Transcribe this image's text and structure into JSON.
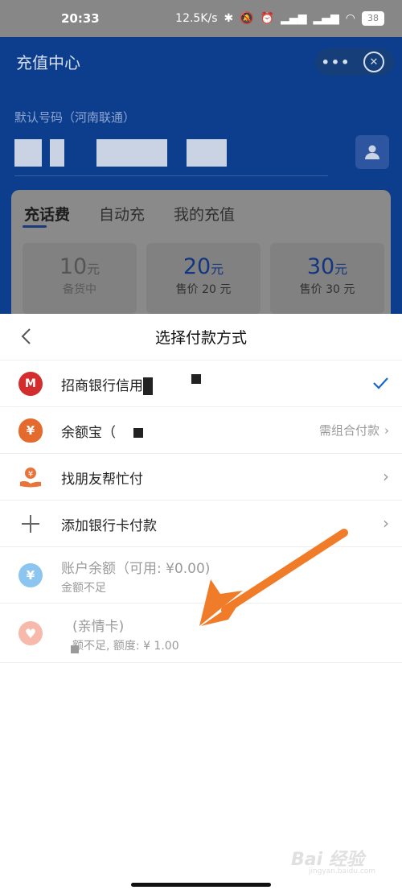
{
  "status_bar": {
    "time": "20:33",
    "network_speed": "12.5K/s",
    "battery": "38",
    "icons": [
      "bluetooth-icon",
      "mute-icon",
      "alarm-icon",
      "signal-icon",
      "signal-icon",
      "wifi-icon",
      "battery-icon"
    ]
  },
  "header": {
    "title": "充值中心",
    "more_label": "•••",
    "default_number_label": "默认号码（河南联通）"
  },
  "recharge_card": {
    "tabs": [
      {
        "label": "充话费",
        "active": true
      },
      {
        "label": "自动充",
        "active": false
      },
      {
        "label": "我的充值",
        "active": false
      }
    ],
    "amounts": [
      {
        "value": "10",
        "unit": "元",
        "sub": "备货中",
        "disabled": true
      },
      {
        "value": "20",
        "unit": "元",
        "sub": "售价 20 元",
        "disabled": false
      },
      {
        "value": "30",
        "unit": "元",
        "sub": "售价 30 元",
        "disabled": false
      }
    ]
  },
  "payment_sheet": {
    "title": "选择付款方式",
    "options": [
      {
        "label": "招商银行信用",
        "icon": "cmb-bank-icon",
        "selected": true,
        "right_text": ""
      },
      {
        "label": "余额宝（",
        "icon": "yuebao-icon",
        "selected": false,
        "right_text": "需组合付款"
      },
      {
        "label": "找朋友帮忙付",
        "icon": "friend-pay-icon",
        "selected": false,
        "right_text": ""
      },
      {
        "label": "添加银行卡付款",
        "icon": "plus-icon",
        "selected": false,
        "right_text": ""
      },
      {
        "label": "账户余额（可用: ¥0.00)",
        "sub": "金额不足",
        "icon": "balance-icon",
        "disabled": true
      },
      {
        "label": "(亲情卡)",
        "sub": "额不足, 额度: ¥ 1.00",
        "icon": "family-card-icon",
        "disabled": true
      }
    ]
  },
  "colors": {
    "header_blue": "#0d3e8e",
    "annotation_orange": "#f07c2a",
    "check_blue": "#1a66d0"
  },
  "watermark": {
    "text": "Bai 经验",
    "sub": "jingyan.baidu.com"
  }
}
